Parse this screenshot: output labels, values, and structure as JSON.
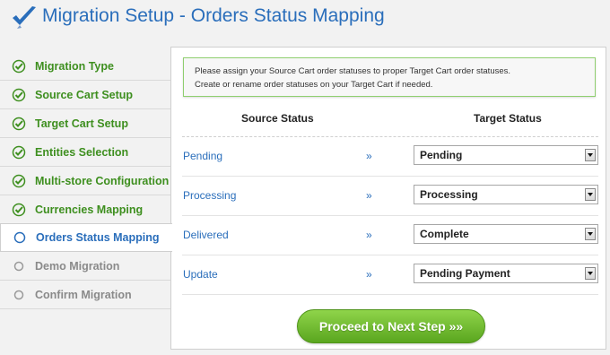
{
  "header": {
    "title": "Migration Setup - Orders Status Mapping",
    "logo_icon": "checkmark-logo-icon"
  },
  "sidebar": {
    "items": [
      {
        "label": "Migration Type",
        "state": "done",
        "icon": "check-circle-icon"
      },
      {
        "label": "Source Cart Setup",
        "state": "done",
        "icon": "check-circle-icon"
      },
      {
        "label": "Target Cart Setup",
        "state": "done",
        "icon": "check-circle-icon"
      },
      {
        "label": "Entities Selection",
        "state": "done",
        "icon": "check-circle-icon"
      },
      {
        "label": "Multi-store Configuration",
        "state": "done",
        "icon": "check-circle-icon"
      },
      {
        "label": "Currencies Mapping",
        "state": "done",
        "icon": "check-circle-icon"
      },
      {
        "label": "Orders Status Mapping",
        "state": "active",
        "icon": "circle-icon"
      },
      {
        "label": "Demo Migration",
        "state": "pending",
        "icon": "circle-icon"
      },
      {
        "label": "Confirm Migration",
        "state": "pending",
        "icon": "circle-icon"
      }
    ]
  },
  "main": {
    "notice_line1": "Please assign your Source Cart order statuses to proper Target Cart order statuses.",
    "notice_line2": "Create or rename order statuses on your Target Cart if needed.",
    "source_header": "Source Status",
    "target_header": "Target Status",
    "arrow": "»",
    "rows": [
      {
        "source": "Pending",
        "target": "Pending"
      },
      {
        "source": "Processing",
        "target": "Processing"
      },
      {
        "source": "Delivered",
        "target": "Complete"
      },
      {
        "source": "Update",
        "target": "Pending Payment"
      }
    ],
    "next_button": "Proceed to Next Step »»"
  },
  "colors": {
    "accent": "#2a6ebb",
    "done": "#3e8f1f",
    "pending": "#8a8a8a",
    "button": "#6cbc2c"
  }
}
